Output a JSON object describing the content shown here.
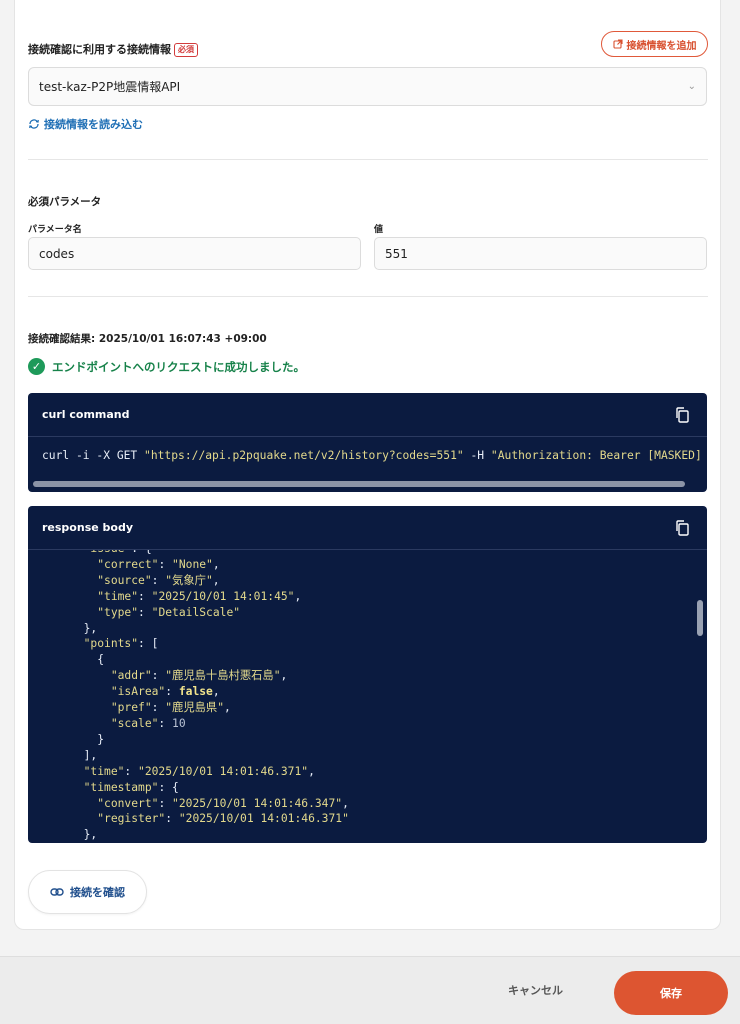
{
  "connection": {
    "label": "接続確認に利用する接続情報",
    "required_badge": "必須",
    "add_button": "接続情報を追加",
    "selected": "test-kaz-P2P地震情報API",
    "load_link": "接続情報を読み込む"
  },
  "params": {
    "section_title": "必須パラメータ",
    "name_label": "パラメータ名",
    "value_label": "値",
    "name_value": "codes",
    "value_value": "551"
  },
  "result": {
    "label": "接続確認結果: 2025/10/01 16:07:43 +09:00",
    "success_message": "エンドポイントへのリクエストに成功しました。"
  },
  "curl": {
    "title": "curl command",
    "cmd_prefix": "curl -i -X GET ",
    "url": "\"https://api.p2pquake.net/v2/history?codes=551\"",
    "flag": " -H ",
    "header": "\"Authorization: Bearer [MASKED]"
  },
  "response": {
    "title": "response body"
  },
  "actions": {
    "confirm": "接続を確認",
    "cancel": "キャンセル",
    "save": "保存"
  },
  "colors": {
    "accent": "#dd5531",
    "code_bg": "#0b1b40",
    "success": "#17824a",
    "link": "#1f6fb5"
  }
}
